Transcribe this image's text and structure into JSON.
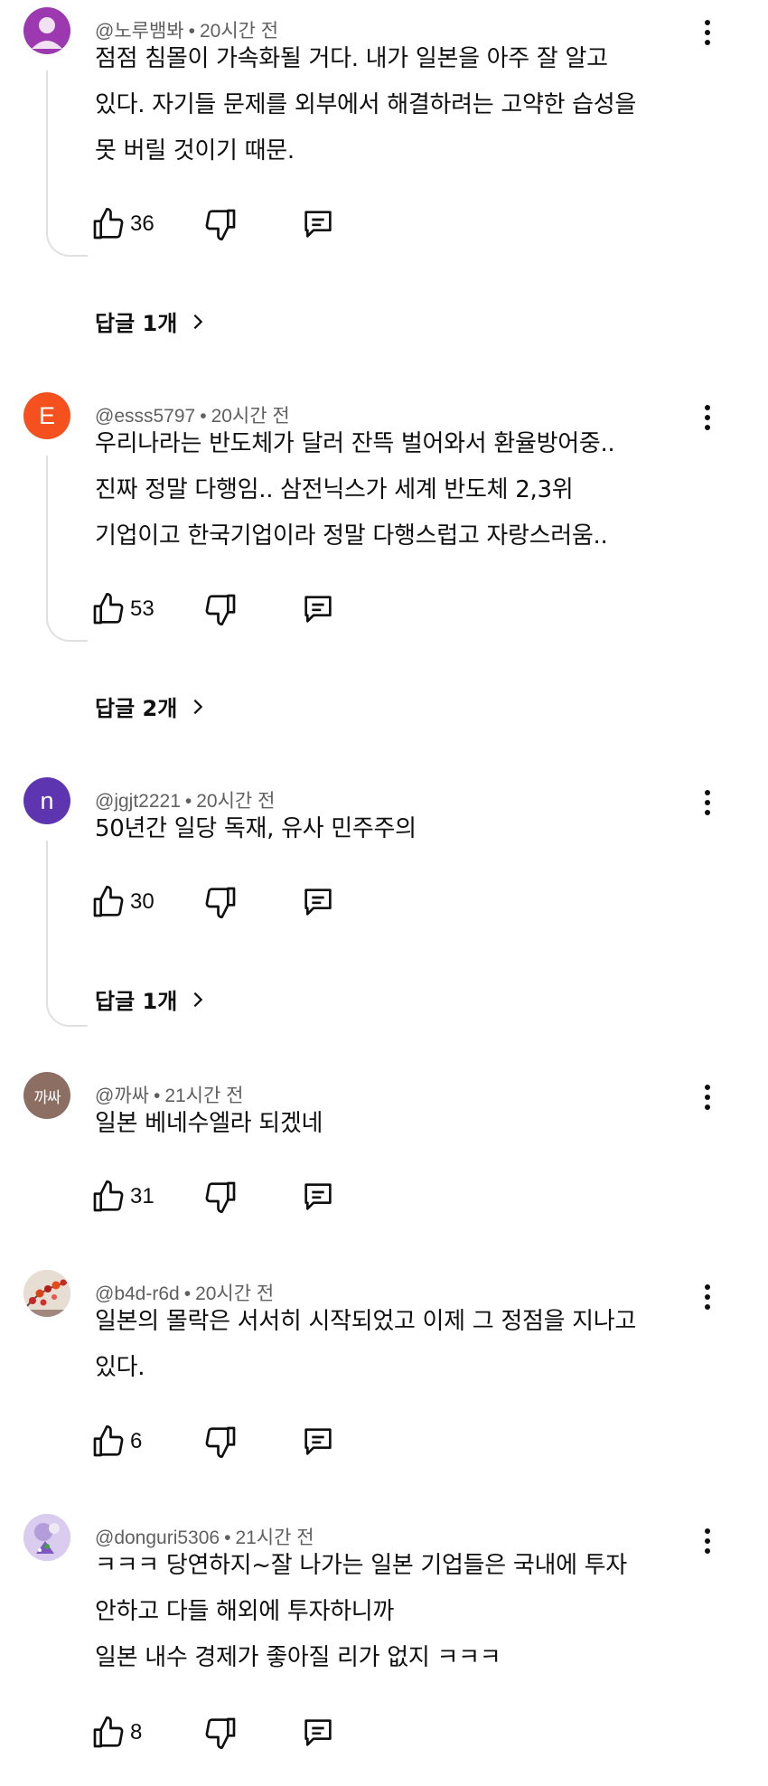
{
  "comments": [
    {
      "author": "@노루뱀봐",
      "time": "20시간 전",
      "text_lines": [
        "점점 침몰이 가속화될 거다. 내가 일본을 아주 잘 알고",
        "있다. 자기들 문제를 외부에서 해결하려는 고약한 습성을",
        "못 버릴 것이기 때문."
      ],
      "likes": "36",
      "replies_label": "답글 1개",
      "avatar": {
        "type": "person-icon",
        "color": "#9c39b0"
      }
    },
    {
      "author": "@esss5797",
      "time": "20시간 전",
      "text_lines": [
        "우리나라는 반도체가 달러 잔뜩 벌어와서 환율방어중..",
        "진짜 정말 다행임.. 삼전닉스가 세계 반도체 2,3위",
        "기업이고 한국기업이라 정말 다행스럽고 자랑스러움.."
      ],
      "likes": "53",
      "replies_label": "답글 2개",
      "avatar": {
        "type": "letter",
        "letter": "E",
        "color": "#f4511e"
      }
    },
    {
      "author": "@jgjt2221",
      "time": "20시간 전",
      "text_lines": [
        "50년간 일당 독재, 유사 민주주의"
      ],
      "likes": "30",
      "replies_label": "답글 1개",
      "avatar": {
        "type": "letter",
        "letter": "n",
        "color": "#5e35b1"
      }
    },
    {
      "author": "@까싸",
      "time": "21시간 전",
      "text_lines": [
        "일본 베네수엘라 되겠네"
      ],
      "likes": "31",
      "avatar": {
        "type": "text",
        "letter": "까싸",
        "color": "#8d6e63"
      }
    },
    {
      "author": "@b4d-r6d",
      "time": "20시간 전",
      "text_lines": [
        "일본의 몰락은 서서히 시작되었고 이제 그 정점을 지나고",
        "있다."
      ],
      "likes": "6",
      "avatar": {
        "type": "photo-flowers",
        "color": "#d8cfc4"
      }
    },
    {
      "author": "@donguri5306",
      "time": "21시간 전",
      "text_lines": [
        "ㅋㅋㅋ 당연하지~잘 나가는 일본 기업들은 국내에 투자",
        "안하고 다들 해외에 투자하니까",
        "일본 내수 경제가 좋아질 리가 없지 ㅋㅋㅋ"
      ],
      "likes": "8",
      "avatar": {
        "type": "photo-character",
        "color": "#c9b8e8"
      }
    }
  ],
  "icons": {
    "like": "thumb-up-icon",
    "dislike": "thumb-down-icon",
    "reply": "comment-icon",
    "more": "kebab-menu-icon",
    "replies_chevron": "chevron-right-icon"
  },
  "separator": "•"
}
